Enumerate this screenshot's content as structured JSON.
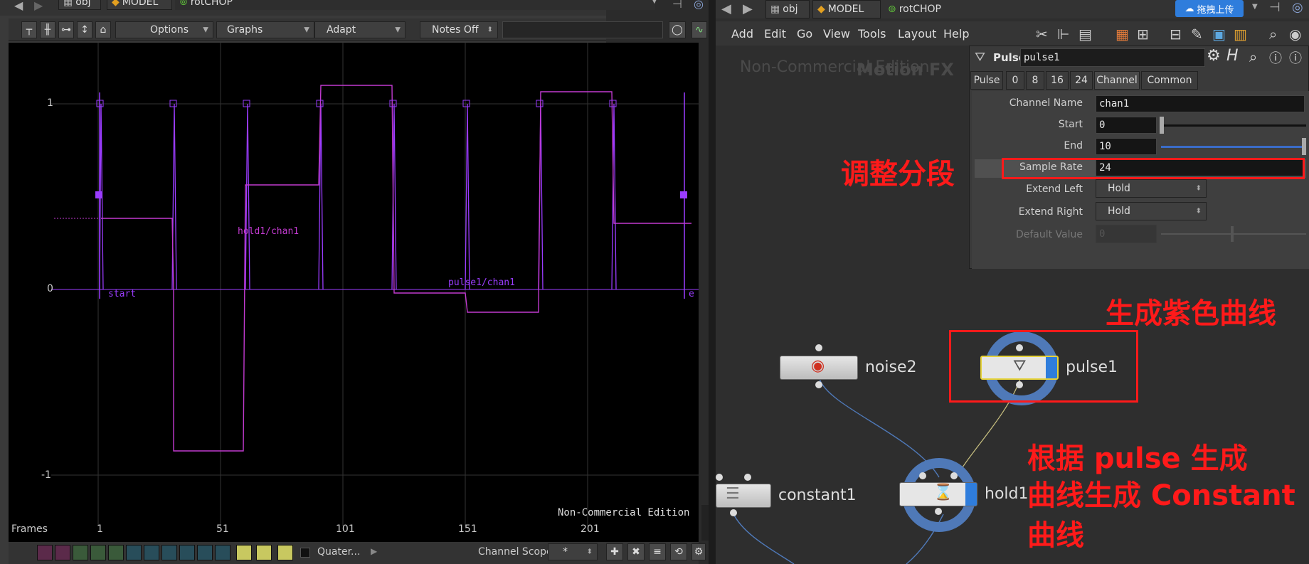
{
  "left_pane": {
    "path": [
      "obj",
      "MODEL",
      "rotCHOP"
    ],
    "toolbar": {
      "options": "Options",
      "graphs": "Graphs",
      "adapt": "Adapt",
      "notes": "Notes Off"
    },
    "graph": {
      "y_labels": [
        "1",
        "0",
        "-1"
      ],
      "x_labels": [
        "1",
        "51",
        "101",
        "151",
        "201"
      ],
      "frames_label": "Frames",
      "curve_labels": [
        "hold1/chan1",
        "pulse1/chan1",
        "start",
        "e"
      ],
      "watermark": "Non-Commercial Edition"
    },
    "bottom_bar": {
      "quater": "Quater...",
      "channel_scope_label": "Channel Scope",
      "channel_scope_value": "*"
    }
  },
  "right_pane": {
    "path": [
      "obj",
      "MODEL",
      "rotCHOP"
    ],
    "upload_button": "拖拽上传",
    "menu": [
      "Add",
      "Edit",
      "Go",
      "View",
      "Tools",
      "Layout",
      "Help"
    ],
    "watermark": "Non-Commercial Edition",
    "watermark2": "Motion FX",
    "param": {
      "op_type": "Pulse",
      "op_name": "pulse1",
      "tabs": [
        "Pulse",
        "0",
        "8",
        "16",
        "24",
        "Channel",
        "Common"
      ],
      "rows": [
        {
          "label": "Channel Name",
          "value": "chan1"
        },
        {
          "label": "Start",
          "value": "0"
        },
        {
          "label": "End",
          "value": "10"
        },
        {
          "label": "Sample Rate",
          "value": "24"
        },
        {
          "label": "Extend Left",
          "value": "Hold"
        },
        {
          "label": "Extend Right",
          "value": "Hold"
        },
        {
          "label": "Default Value",
          "value": "0"
        }
      ]
    },
    "nodes": {
      "noise2": "noise2",
      "pulse1": "pulse1",
      "constant1": "constant1",
      "hold1": "hold1"
    },
    "notes": {
      "adjust": "调整分段",
      "purple": "生成紫色曲线",
      "line1": "根据 pulse 生成",
      "line2": "曲线生成 Constant",
      "line3": "曲线"
    }
  },
  "colors": {
    "purple": "#9b3cff",
    "magenta": "#c23ad0",
    "red": "#ff1a1a",
    "node_blue": "#4f79b8"
  }
}
